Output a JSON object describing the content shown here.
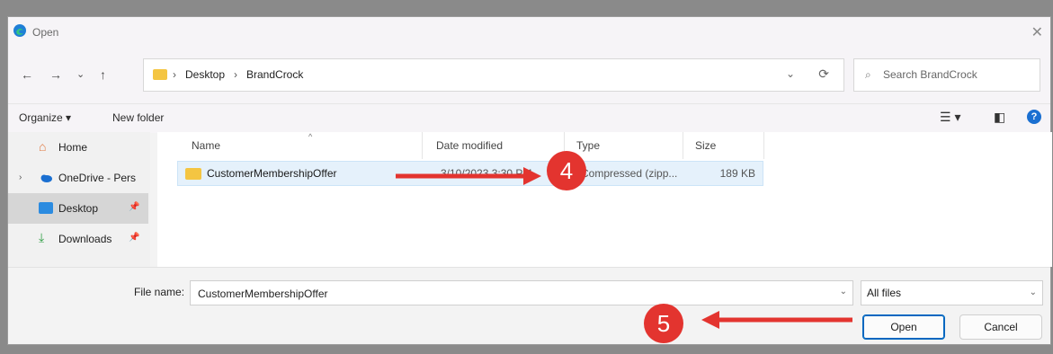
{
  "window": {
    "title": "Open",
    "close_glyph": "✕"
  },
  "nav": {
    "back_glyph": "←",
    "forward_glyph": "→",
    "recent_glyph": "⌄",
    "up_glyph": "↑",
    "breadcrumb": [
      "Desktop",
      "BrandCrock"
    ],
    "crumb_sep": "›",
    "search_placeholder": "Search BrandCrock"
  },
  "toolbar": {
    "organize": "Organize ▾",
    "new_folder": "New folder"
  },
  "sidebar": {
    "items": [
      {
        "label": "Home"
      },
      {
        "label": "OneDrive - Pers"
      },
      {
        "label": "Desktop"
      },
      {
        "label": "Downloads"
      }
    ]
  },
  "columns": {
    "name": "Name",
    "date": "Date modified",
    "type": "Type",
    "size": "Size"
  },
  "files": [
    {
      "name": "CustomerMembershipOffer",
      "date": "3/10/2023 3:30 PM",
      "type": "Compressed (zipp...",
      "size": "189 KB"
    }
  ],
  "bottom": {
    "filename_label": "File name:",
    "filename_value": "CustomerMembershipOffer",
    "filter_value": "All files",
    "open_label": "Open",
    "cancel_label": "Cancel"
  },
  "annotations": {
    "step4": "4",
    "step5": "5"
  },
  "colors": {
    "accent": "#0067c0",
    "annotation": "#e3342f",
    "folder": "#f4c542"
  }
}
